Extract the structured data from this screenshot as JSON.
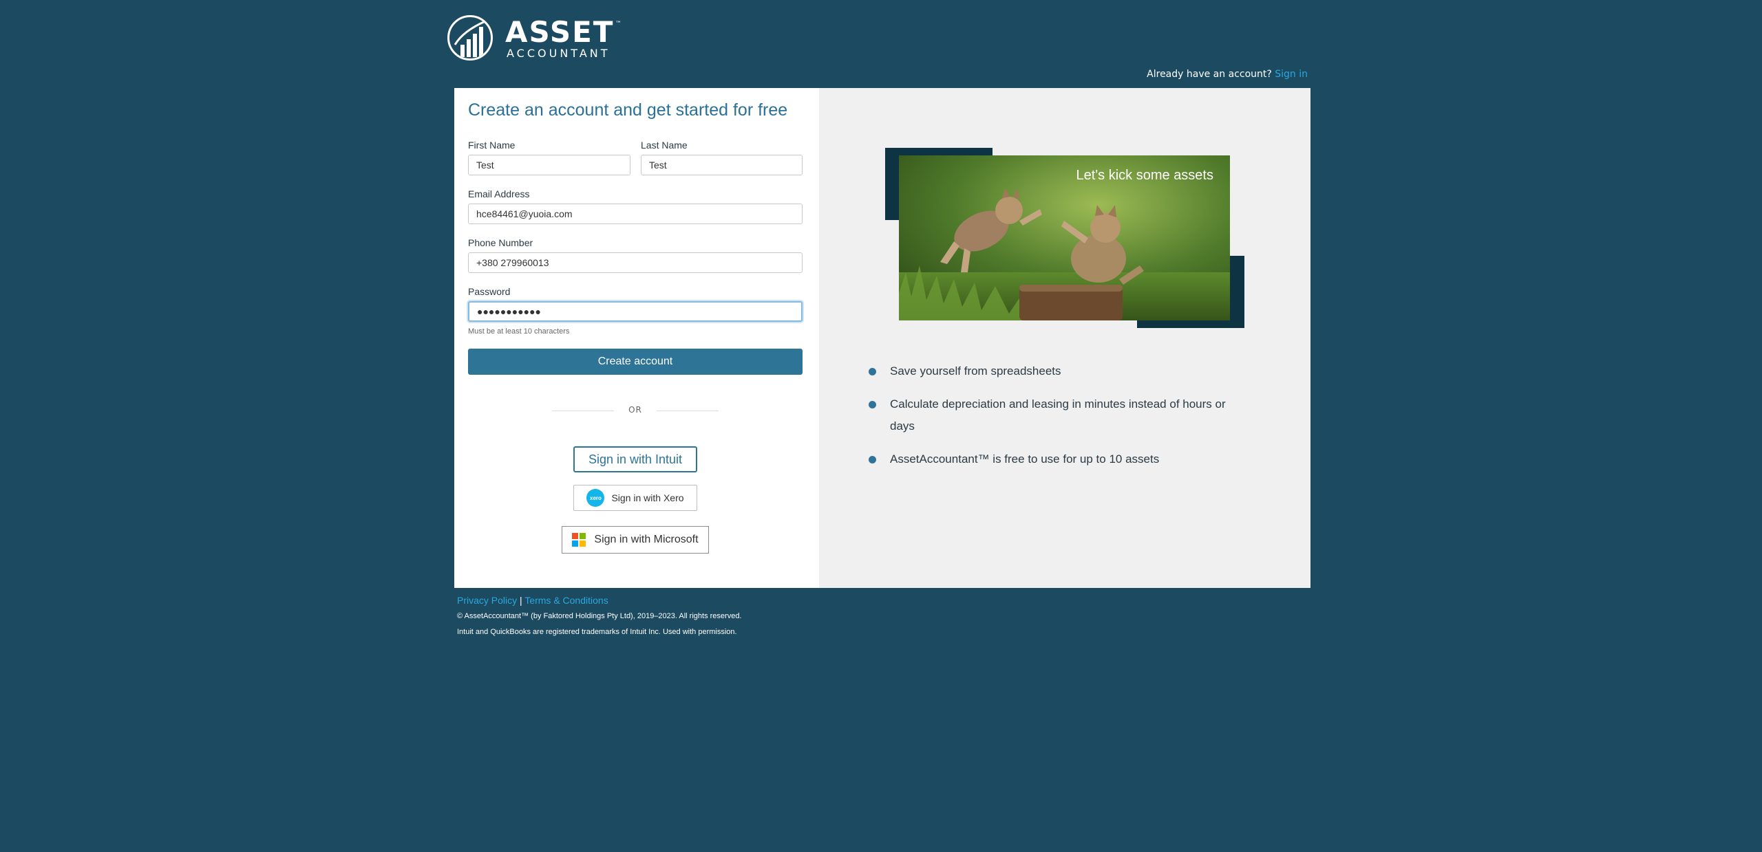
{
  "brand": {
    "name": "ASSET",
    "tm": "™",
    "sub": "ACCOUNTANT"
  },
  "header": {
    "already_text": "Already have an account?",
    "signin_link": "Sign in"
  },
  "form": {
    "title": "Create an account and get started for free",
    "first_name_label": "First Name",
    "first_name_value": "Test",
    "last_name_label": "Last Name",
    "last_name_value": "Test",
    "email_label": "Email Address",
    "email_value": "hce84461@yuoia.com",
    "phone_label": "Phone Number",
    "phone_value": "+380 279960013",
    "password_label": "Password",
    "password_value": "●●●●●●●●●●●",
    "password_hint": "Must be at least 10 characters",
    "create_button": "Create account",
    "or_text": "OR",
    "intuit_button": "Sign in with Intuit",
    "xero_button": "Sign in with Xero",
    "xero_logo_text": "xero",
    "microsoft_button": "Sign in with Microsoft"
  },
  "promo": {
    "image_caption": "Let's kick some assets",
    "bullets": [
      "Save yourself from spreadsheets",
      "Calculate depreciation and leasing in minutes instead of hours or days",
      "AssetAccountant™ is free to use for up to 10 assets"
    ]
  },
  "footer": {
    "privacy": "Privacy Policy",
    "separator": "|",
    "terms": "Terms & Conditions",
    "copyright": "© AssetAccountant™ (by Faktored Holdings Pty Ltd), 2019–2023. All rights reserved.",
    "trademark": "Intuit and QuickBooks are registered trademarks of Intuit Inc. Used with permission."
  },
  "colors": {
    "background": "#1c4a60",
    "primary": "#2d7497",
    "link": "#2aa8e0",
    "panel": "#f0f0f0"
  }
}
